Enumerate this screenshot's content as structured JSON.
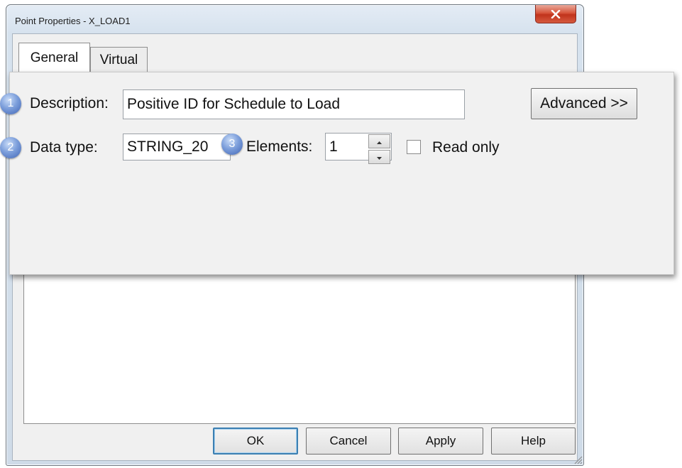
{
  "window": {
    "title": "Point Properties - X_LOAD1",
    "close_icon": "close-icon"
  },
  "tabs": [
    {
      "label": "General",
      "active": true
    },
    {
      "label": "Virtual",
      "active": false
    }
  ],
  "buttons": {
    "ok": "OK",
    "cancel": "Cancel",
    "apply": "Apply",
    "help": "Help"
  },
  "general": {
    "description_label": "Description:",
    "description_value": "Positive ID for Schedule to Load",
    "advanced_label": "Advanced >>",
    "data_type_label": "Data type:",
    "data_type_value": "STRING_20",
    "elements_label": "Elements:",
    "elements_value": "1",
    "read_only_label": "Read only",
    "read_only_checked": false
  },
  "callouts": [
    {
      "number": "1"
    },
    {
      "number": "2"
    },
    {
      "number": "3"
    }
  ]
}
